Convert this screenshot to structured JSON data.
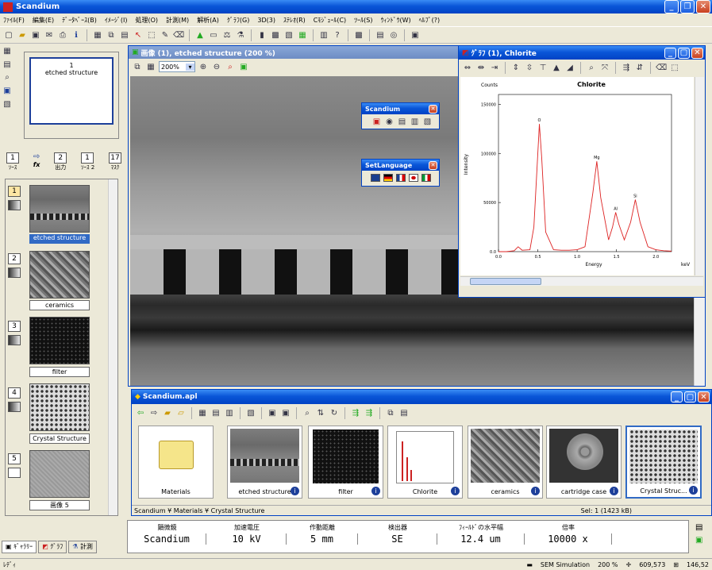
{
  "app": {
    "title": "Scandium"
  },
  "menu": [
    "ﾌｧｲﾙ(F)",
    "編集(E)",
    "ﾃﾞｰﾀﾍﾞｰｽ(B)",
    "ｲﾒｰｼﾞ(I)",
    "処理(O)",
    "計測(M)",
    "解析(A)",
    "ｸﾞﾗﾌ(G)",
    "3D(3)",
    "ｽﾃﾚｵ(R)",
    "Cﾓｼﾞｭｰﾙ(C)",
    "ﾂｰﾙ(S)",
    "ｳｨﾝﾄﾞｳ(W)",
    "ﾍﾙﾌﾟ(?)"
  ],
  "left": {
    "preview": {
      "number": "1",
      "label": "etched structure"
    },
    "source": [
      {
        "n": "1",
        "label": "ｿｰｽ"
      },
      {
        "n": "fx",
        "label": "fx"
      },
      {
        "n": "2",
        "label": "出力"
      },
      {
        "n": "1",
        "label": "ｿｰｽ 2"
      },
      {
        "n": "17",
        "label": "ﾏｽｸ"
      }
    ],
    "items": [
      {
        "n": "1",
        "label": "etched structure"
      },
      {
        "n": "2",
        "label": "ceramics"
      },
      {
        "n": "3",
        "label": "filter"
      },
      {
        "n": "4",
        "label": "Crystal Structure"
      },
      {
        "n": "5",
        "label": "画像 5"
      }
    ],
    "tabs": [
      "ｷﾞｬﾗﾘｰ",
      "ｸﾞﾗﾌ",
      "計測"
    ]
  },
  "image_window": {
    "title": "画像 (1), etched structure (200 %)",
    "zoom": "200%"
  },
  "float_scandium": {
    "title": "Scandium"
  },
  "float_lang": {
    "title": "SetLanguage"
  },
  "graph_window": {
    "title": "ｸﾞﾗﾌ (1), Chlorite"
  },
  "chart_data": {
    "type": "line",
    "title": "Chlorite",
    "counts_label": "Counts",
    "xlabel": "Energy",
    "ylabel": "Intensity",
    "x_unit": "keV",
    "xlim": [
      0,
      2.2
    ],
    "ylim": [
      0,
      160000
    ],
    "yticks": [
      "150000",
      "100000",
      "50000",
      "0.0"
    ],
    "xticks": [
      "0.0",
      "0.5",
      "1.0",
      "1.5",
      "2.0"
    ],
    "peaks": [
      {
        "label": "O",
        "x": 0.52,
        "y": 130000
      },
      {
        "label": "Mg",
        "x": 1.25,
        "y": 92000
      },
      {
        "label": "Al",
        "x": 1.49,
        "y": 40000
      },
      {
        "label": "Si",
        "x": 1.74,
        "y": 53000
      }
    ],
    "series": [
      {
        "x": [
          0.0,
          0.1,
          0.2,
          0.25,
          0.3,
          0.4,
          0.45,
          0.5,
          0.52,
          0.55,
          0.6,
          0.7,
          0.8,
          0.9,
          1.0,
          1.1,
          1.2,
          1.25,
          1.3,
          1.4,
          1.45,
          1.49,
          1.53,
          1.6,
          1.68,
          1.74,
          1.8,
          1.9,
          2.0,
          2.1,
          2.2
        ],
        "y": [
          0,
          0,
          1000,
          5000,
          1500,
          2000,
          25000,
          100000,
          130000,
          95000,
          20000,
          2000,
          1500,
          1500,
          2000,
          5000,
          60000,
          92000,
          55000,
          12000,
          25000,
          40000,
          28000,
          12000,
          30000,
          53000,
          30000,
          5000,
          2000,
          1000,
          500
        ]
      }
    ]
  },
  "browser": {
    "title": "Scandium.apl",
    "tiles": [
      "Materials",
      "etched structure",
      "filter",
      "Chlorite",
      "ceramics",
      "cartridge case",
      "Crystal Struc..."
    ],
    "path": "Scandium ¥ Materials ¥ Crystal Structure",
    "sel": "Sel: 1  (1423 kB)"
  },
  "info": {
    "headers": [
      "顕微鏡",
      "加速電圧",
      "作動距離",
      "検出器",
      "ﾌｨｰﾙﾄﾞの水平幅",
      "倍率"
    ],
    "values": [
      "Scandium",
      "10 kV",
      "5 mm",
      "SE",
      "12.4 um",
      "10000 x"
    ]
  },
  "status": {
    "ready": "ﾚﾃﾞｨ",
    "sem": "SEM Simulation",
    "zoom": "200 %",
    "coord": "609,573",
    "size": "146,52"
  }
}
